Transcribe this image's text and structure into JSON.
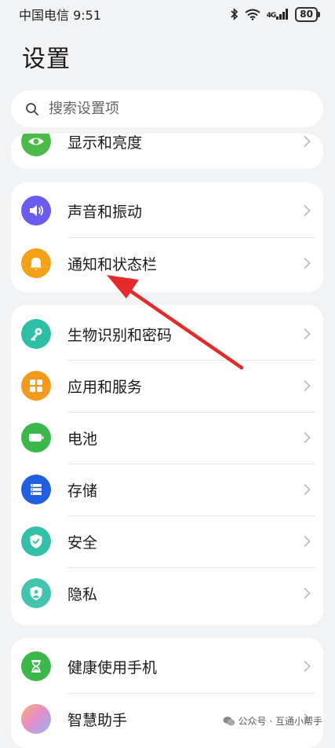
{
  "status_bar": {
    "carrier_time": "中国电信 9:51",
    "signal_label": "4G",
    "battery": "80"
  },
  "header": {
    "title": "设置"
  },
  "search": {
    "placeholder": "搜索设置项"
  },
  "cards": [
    {
      "items": [
        {
          "label": "显示和亮度",
          "icon": "eye-icon",
          "color": "#4cbb4a"
        }
      ]
    },
    {
      "items": [
        {
          "label": "声音和振动",
          "icon": "speaker-icon",
          "color": "#6a5cf0"
        },
        {
          "label": "通知和状态栏",
          "icon": "bell-icon",
          "color": "#f3a117"
        }
      ]
    },
    {
      "items": [
        {
          "label": "生物识别和密码",
          "icon": "key-icon",
          "color": "#2cbfa6"
        },
        {
          "label": "应用和服务",
          "icon": "apps-grid-icon",
          "color": "#f39a1c"
        },
        {
          "label": "电池",
          "icon": "battery-icon",
          "color": "#3bb84a"
        },
        {
          "label": "存储",
          "icon": "storage-icon",
          "color": "#1f5fe0"
        },
        {
          "label": "安全",
          "icon": "shield-check-icon",
          "color": "#34c0a8"
        },
        {
          "label": "隐私",
          "icon": "privacy-shield-icon",
          "color": "#42c4ae"
        }
      ]
    },
    {
      "items": [
        {
          "label": "健康使用手机",
          "icon": "hourglass-icon",
          "color": "#3cb84a"
        },
        {
          "label": "智慧助手",
          "icon": "assistant-orb-icon",
          "color": "#c58af0"
        }
      ]
    }
  ],
  "annotation": {
    "color": "#e52a2a"
  },
  "watermark": {
    "text": "公众号 · 互通小帮手"
  }
}
